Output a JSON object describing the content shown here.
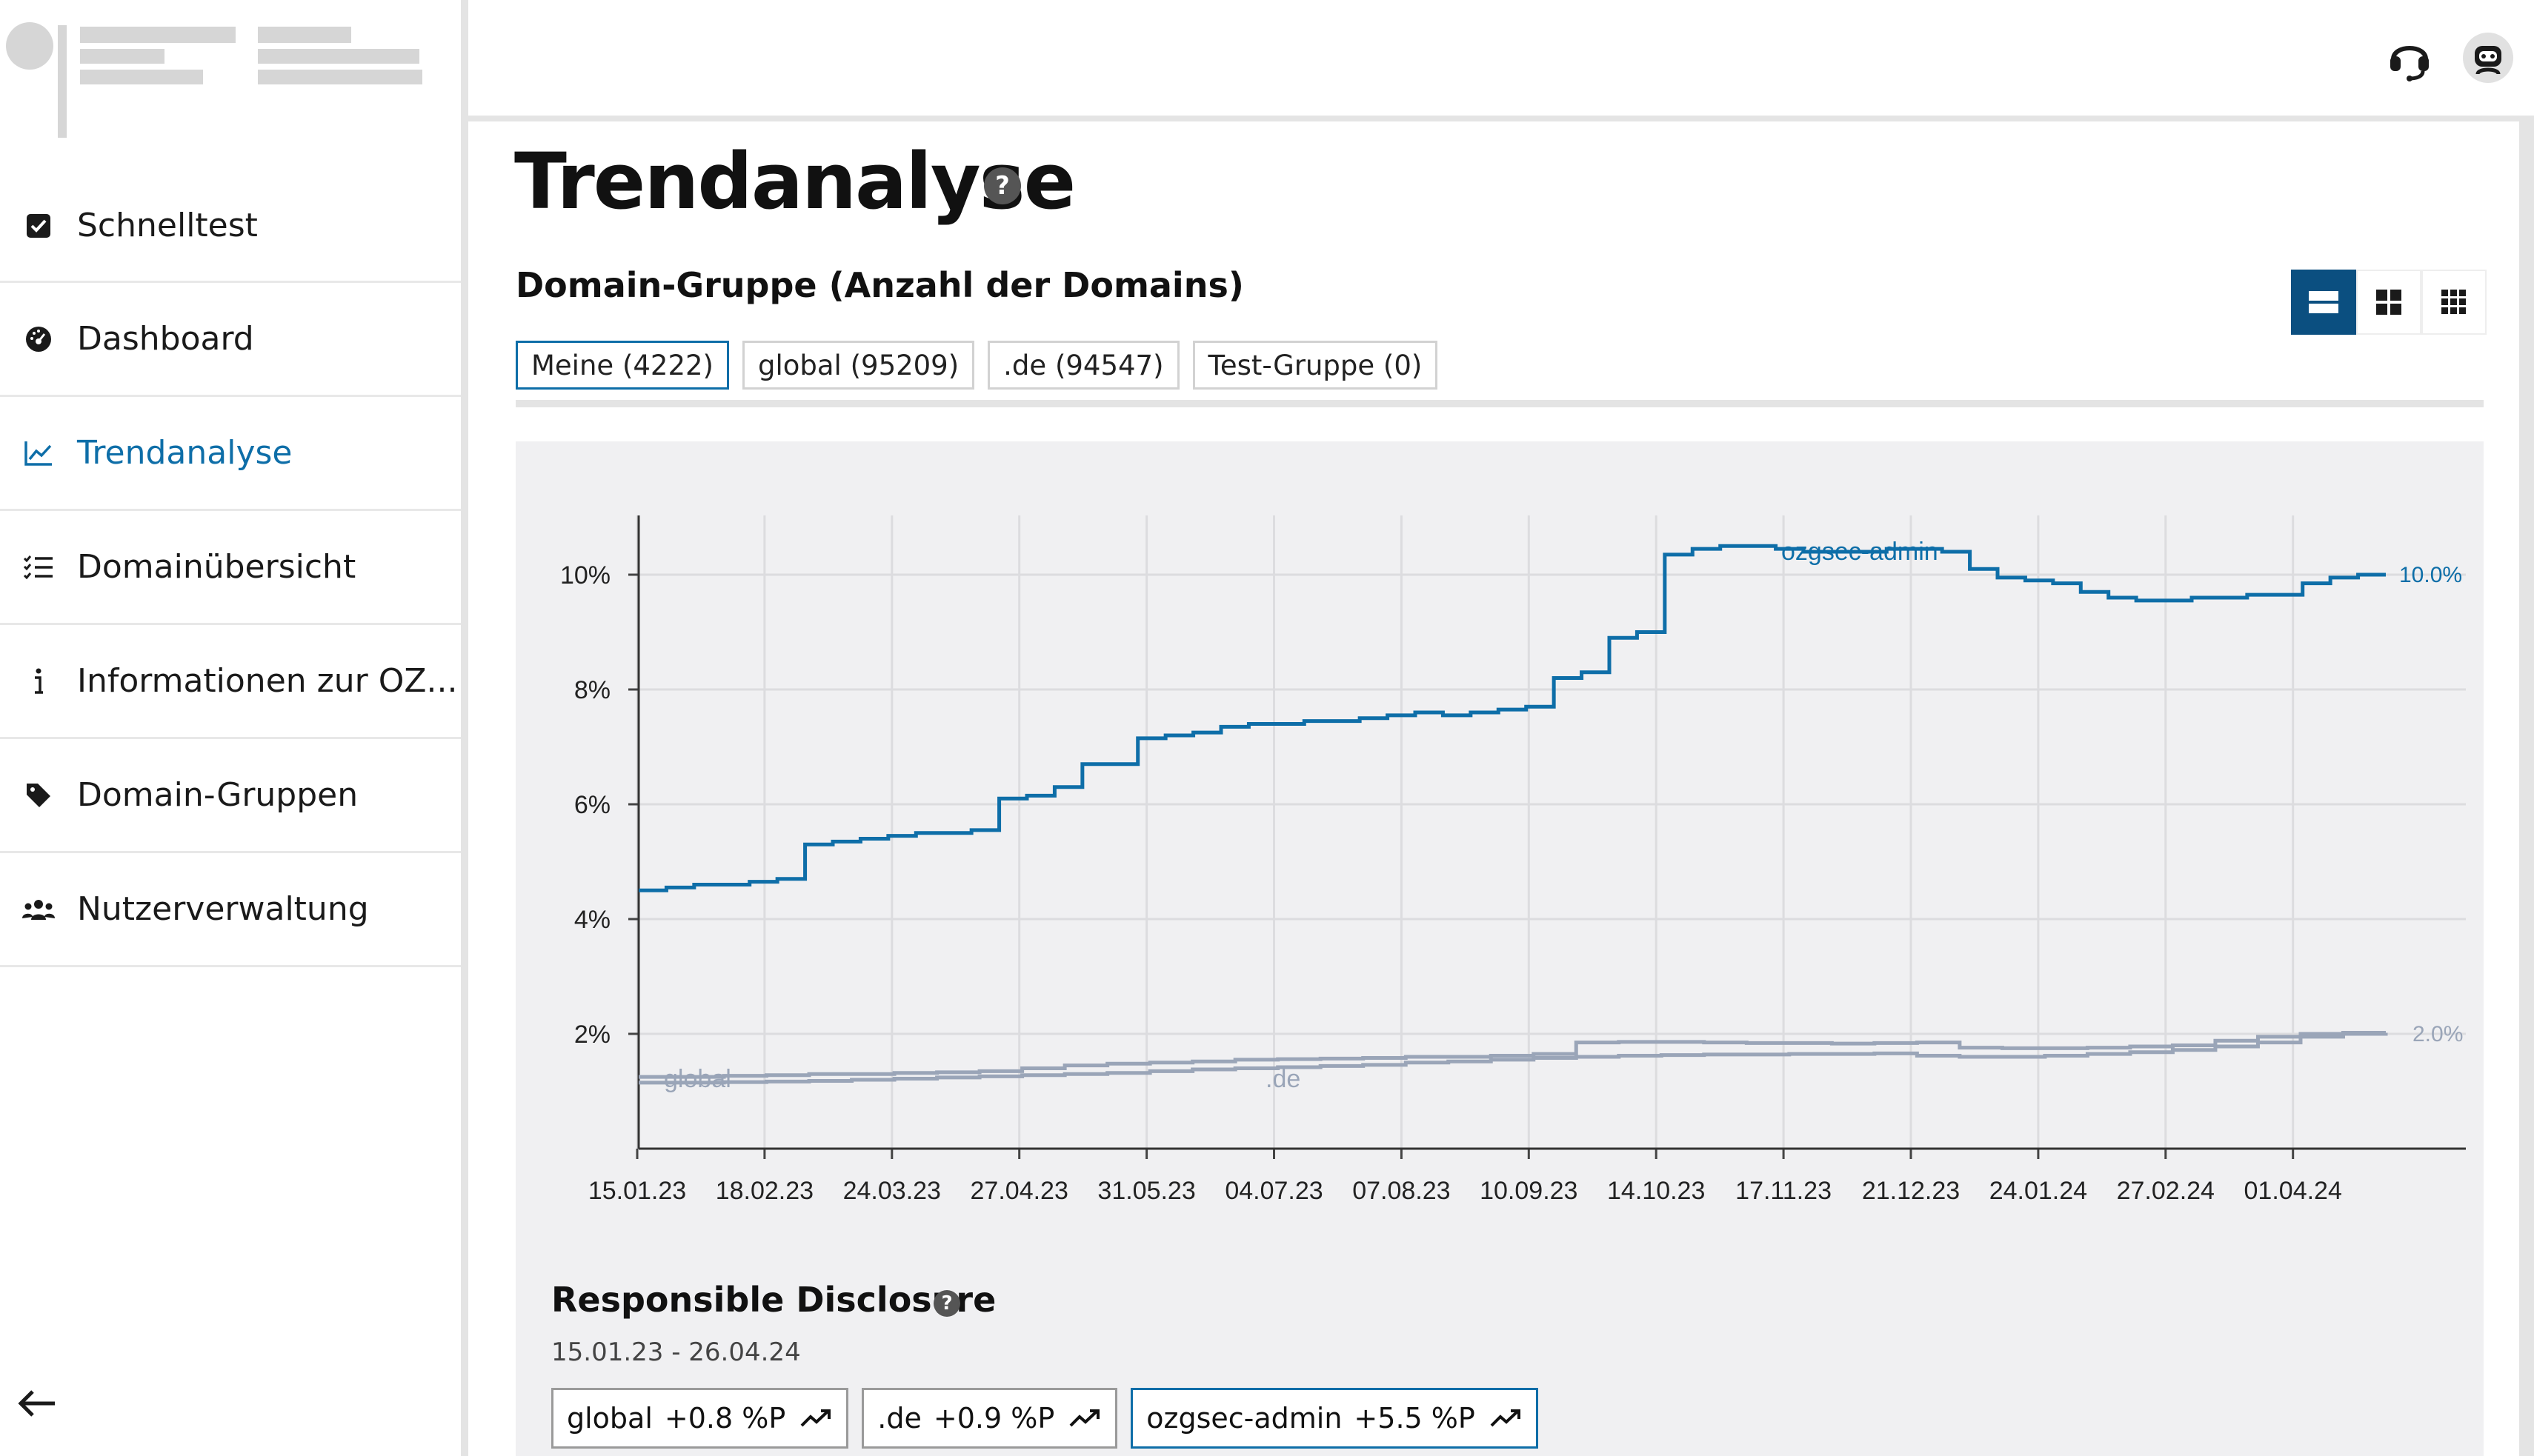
{
  "sidebar": {
    "items": [
      {
        "label": "Schnelltest",
        "icon": "checkbox-icon"
      },
      {
        "label": "Dashboard",
        "icon": "gauge-icon"
      },
      {
        "label": "Trendanalyse",
        "icon": "chart-line-icon",
        "active": true
      },
      {
        "label": "Domainübersicht",
        "icon": "list-check-icon"
      },
      {
        "label": "Informationen zur OZ...",
        "icon": "info-icon"
      },
      {
        "label": "Domain-Gruppen",
        "icon": "tag-icon"
      },
      {
        "label": "Nutzerverwaltung",
        "icon": "users-icon"
      }
    ]
  },
  "header": {
    "support_icon": "headset-icon",
    "profile_icon": "avatar-icon"
  },
  "main": {
    "title": "Trendanalyse",
    "group_section": "Domain-Gruppe (Anzahl der Domains)",
    "tabs": [
      {
        "label": "Meine (4222)",
        "active": true
      },
      {
        "label": "global (95209)"
      },
      {
        "label": ".de (94547)"
      },
      {
        "label": "Test-Gruppe (0)"
      }
    ],
    "view_modes": [
      "one-column-icon",
      "two-column-icon",
      "three-column-icon"
    ]
  },
  "chart_data": {
    "type": "line",
    "x_labels": [
      "15.01.23",
      "18.02.23",
      "24.03.23",
      "27.04.23",
      "31.05.23",
      "04.07.23",
      "07.08.23",
      "10.09.23",
      "14.10.23",
      "17.11.23",
      "21.12.23",
      "24.01.24",
      "27.02.24",
      "01.04.24"
    ],
    "y_ticks": [
      "2%",
      "4%",
      "6%",
      "8%",
      "10%"
    ],
    "ylim": [
      0,
      11
    ],
    "grid": true,
    "series": [
      {
        "name": "ozgsec-admin",
        "color": "#0e6ea8",
        "end_label": "10.0%",
        "values": [
          4.5,
          4.55,
          4.6,
          4.6,
          4.65,
          4.7,
          5.3,
          5.35,
          5.4,
          5.45,
          5.5,
          5.5,
          5.55,
          6.1,
          6.15,
          6.3,
          6.7,
          6.7,
          7.15,
          7.2,
          7.25,
          7.35,
          7.4,
          7.4,
          7.45,
          7.45,
          7.5,
          7.55,
          7.6,
          7.55,
          7.6,
          7.65,
          7.7,
          8.2,
          8.3,
          8.9,
          9.0,
          10.35,
          10.45,
          10.5,
          10.5,
          10.45,
          10.4,
          10.4,
          10.4,
          10.45,
          10.45,
          10.4,
          10.1,
          9.95,
          9.9,
          9.85,
          9.7,
          9.6,
          9.55,
          9.55,
          9.6,
          9.6,
          9.65,
          9.65,
          9.85,
          9.95,
          10.0,
          10.0
        ]
      },
      {
        "name": "global",
        "color": "#9aa5b8",
        "end_label": "2.0%",
        "values": [
          1.25,
          1.25,
          1.27,
          1.28,
          1.3,
          1.3,
          1.32,
          1.33,
          1.35,
          1.4,
          1.45,
          1.48,
          1.5,
          1.52,
          1.55,
          1.56,
          1.57,
          1.58,
          1.6,
          1.6,
          1.62,
          1.65,
          1.85,
          1.86,
          1.86,
          1.85,
          1.84,
          1.84,
          1.83,
          1.84,
          1.85,
          1.76,
          1.75,
          1.75,
          1.76,
          1.78,
          1.8,
          1.88,
          1.95,
          2.0,
          2.02,
          2.02
        ]
      },
      {
        "name": ".de",
        "color": "#9aa5b8",
        "values": [
          1.15,
          1.15,
          1.16,
          1.17,
          1.18,
          1.2,
          1.22,
          1.24,
          1.26,
          1.28,
          1.3,
          1.32,
          1.35,
          1.38,
          1.4,
          1.42,
          1.44,
          1.46,
          1.5,
          1.52,
          1.55,
          1.58,
          1.6,
          1.62,
          1.63,
          1.64,
          1.64,
          1.65,
          1.65,
          1.66,
          1.62,
          1.6,
          1.6,
          1.62,
          1.65,
          1.68,
          1.72,
          1.78,
          1.85,
          1.95,
          2.0,
          2.02
        ]
      }
    ]
  },
  "disclosure": {
    "title": "Responsible Disclosure",
    "range": "15.01.23 - 26.04.24",
    "chips": [
      {
        "name": "global",
        "value": "+0.8 %P"
      },
      {
        "name": ".de",
        "value": "+0.9 %P"
      },
      {
        "name": "ozgsec-admin",
        "value": "+5.5 %P",
        "active": true
      }
    ]
  }
}
